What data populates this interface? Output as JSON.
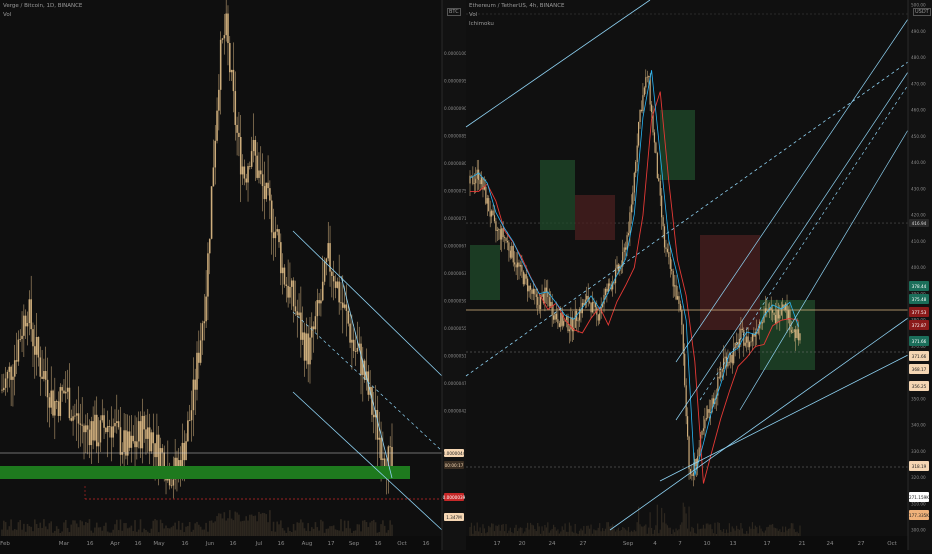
{
  "left_panel": {
    "title": "Verge / Bitcoin, 1D, BINANCE",
    "indicator": "Vol",
    "currency_tag": "BTC",
    "price_tags": [
      {
        "text": "0.0000044",
        "bg": "#f5d6b3",
        "fg": "#222222"
      },
      {
        "text": "00:00:17",
        "bg": "#3a2e22",
        "fg": "#f5d6b3"
      },
      {
        "text": "0.0000039",
        "bg": "#c62828",
        "fg": "#ffffff"
      },
      {
        "text": "1.347M",
        "bg": "#f5d6b3",
        "fg": "#222222"
      }
    ]
  },
  "right_panel": {
    "title": "Ethereum / TetherUS, 4h, BINANCE",
    "indicators": [
      "Vol",
      "Ichimoku"
    ],
    "currency_tag": "USDT",
    "price_tags": [
      {
        "text": "378.44",
        "bg": "#1b6e5a",
        "fg": "#ffffff"
      },
      {
        "text": "375.48",
        "bg": "#1b6e5a",
        "fg": "#ffffff"
      },
      {
        "text": "377.53",
        "bg": "#8b1a1a",
        "fg": "#ffffff"
      },
      {
        "text": "372.87",
        "bg": "#8b1a1a",
        "fg": "#ffffff"
      },
      {
        "text": "371.66",
        "bg": "#1b6e5a",
        "fg": "#ffffff"
      },
      {
        "text": "371.66",
        "bg": "#f5d6b3",
        "fg": "#222222"
      },
      {
        "text": "368.17",
        "bg": "#f5d6b3",
        "fg": "#222222"
      },
      {
        "text": "356.25",
        "bg": "#f5d6b3",
        "fg": "#222222"
      },
      {
        "text": "318.19",
        "bg": "#f5d6b3",
        "fg": "#222222"
      },
      {
        "text": "271.159K",
        "bg": "#ffffff",
        "fg": "#222222"
      },
      {
        "text": "177.335K",
        "bg": "#f0b27a",
        "fg": "#222222"
      }
    ],
    "marked_level": "416.94"
  },
  "colors": {
    "background": "#0e0e0e",
    "candle": "#d8b682",
    "trendline": "#8fd3f4",
    "green_zone": "#1e7a1e",
    "red_dashed": "#c62828",
    "kijun": "#e53935",
    "tenkan": "#29b6f6",
    "kumo_bull": "#1f4a2a",
    "kumo_bear": "#4a1f1f"
  },
  "chart_data": [
    {
      "type": "candlestick",
      "title": "Verge / Bitcoin, 1D, BINANCE",
      "x_ticks": [
        "Feb",
        "Mar",
        "16",
        "Apr",
        "16",
        "May",
        "16",
        "Jun",
        "16",
        "Jul",
        "16",
        "Aug",
        "17",
        "Sep",
        "16",
        "Oct",
        "16"
      ],
      "y_ticks": [],
      "current_price": 4.4e-06,
      "levels": {
        "support_zone": "green",
        "marked_low": 3.9e-06
      },
      "close_path": [
        22,
        25,
        29,
        35,
        40,
        32,
        27,
        24,
        19,
        20,
        22,
        17,
        15,
        13,
        14,
        12,
        14,
        15,
        12,
        10,
        9,
        11,
        14,
        13,
        10,
        8,
        5,
        4,
        7,
        13,
        21,
        33,
        45,
        70,
        92,
        100,
        86,
        74,
        68,
        75,
        69,
        64,
        60,
        55,
        47,
        43,
        39,
        33,
        30,
        36,
        42,
        50,
        47,
        41,
        37,
        31,
        29,
        23,
        17,
        12,
        8,
        5
      ],
      "y_range_note": "relative price"
    },
    {
      "type": "candlestick",
      "title": "Ethereum / TetherUS, 4h, BINANCE",
      "x_ticks": [
        "17",
        "20",
        "24",
        "27",
        "Sep",
        "4",
        "7",
        "10",
        "13",
        "17",
        "21",
        "24",
        "27",
        "Oct"
      ],
      "y_ticks": [
        "500.00",
        "490.00",
        "480.00",
        "470.00",
        "460.00",
        "450.00",
        "440.00",
        "430.00",
        "420.00",
        "410.00",
        "400.00",
        "390.00",
        "380.00",
        "370.00",
        "360.00",
        "350.00",
        "340.00",
        "330.00",
        "320.00",
        "310.00",
        "300.00"
      ],
      "left_y_ticks": [
        "0.0000100",
        "0.0000095",
        "0.0000090",
        "0.0000085",
        "0.0000080",
        "0.0000075",
        "0.0000071",
        "0.0000067",
        "0.0000063",
        "0.0000059",
        "0.0000055",
        "0.0000051",
        "0.0000047",
        "0.0000042"
      ],
      "ylim": [
        300,
        500
      ],
      "close_path": [
        432,
        436,
        425,
        414,
        412,
        405,
        398,
        392,
        386,
        390,
        382,
        379,
        378,
        384,
        388,
        381,
        390,
        396,
        402,
        420,
        458,
        474,
        440,
        408,
        395,
        380,
        318,
        330,
        343,
        352,
        365,
        366,
        374,
        371,
        378,
        385,
        380,
        388,
        377,
        372
      ]
    }
  ]
}
